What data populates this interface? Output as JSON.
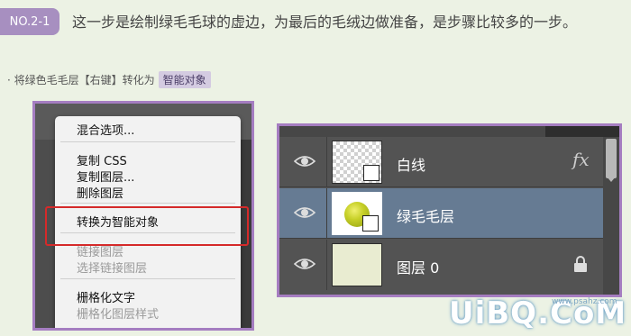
{
  "step": {
    "badge": "NO.2-1",
    "headline": "这一步是绘制绿毛毛球的虚边，为最后的毛绒边做准备，是步骤比较多的一步。"
  },
  "instruction": {
    "prefix": "· 将绿色毛毛层【右键】转化为",
    "highlight": "智能对象"
  },
  "context_menu": {
    "items": [
      {
        "label": "混合选项...",
        "enabled": true
      },
      {
        "label": "复制 CSS",
        "enabled": true
      },
      {
        "label": "复制图层...",
        "enabled": true
      },
      {
        "label": "删除图层",
        "enabled": true
      },
      {
        "label": "转换为智能对象",
        "enabled": true,
        "highlighted": true
      },
      {
        "label": "链接图层",
        "enabled": false
      },
      {
        "label": "选择链接图层",
        "enabled": false
      },
      {
        "label": "栅格化文字",
        "enabled": true
      },
      {
        "label": "栅格化图层样式",
        "enabled": false
      }
    ]
  },
  "layers_panel": {
    "layers": [
      {
        "name": "白线",
        "thumbnail": "transparent-checker",
        "effects": "fx",
        "selected": false
      },
      {
        "name": "绿毛毛层",
        "thumbnail": "green-ball-smart-object",
        "selected": true
      },
      {
        "name": "图层 0",
        "thumbnail": "cream-fill",
        "locked": true,
        "selected": false
      }
    ]
  },
  "watermark": {
    "text": "UiBQ.CoM",
    "url": "www.psahz.com"
  },
  "colors": {
    "badge": "#a78fc0",
    "frame": "#a57dc1",
    "highlight_box": "#d52a2a",
    "selected_layer": "#667b93",
    "page_bg": "#ecf2e4"
  }
}
